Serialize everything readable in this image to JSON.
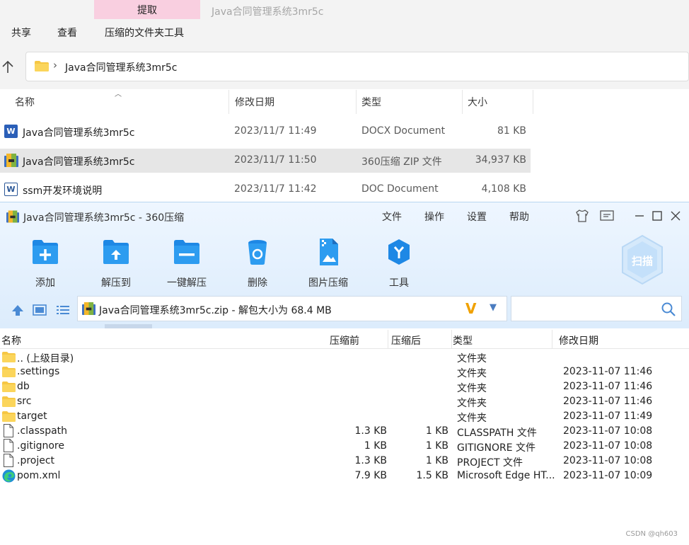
{
  "explorer": {
    "extract_tab": "提取",
    "window_title": "Java合同管理系统3mr5c",
    "menu": [
      "共享",
      "查看",
      "压缩的文件夹工具"
    ],
    "address": "Java合同管理系统3mr5c",
    "columns": [
      "名称",
      "修改日期",
      "类型",
      "大小"
    ],
    "files": [
      {
        "name": "Java合同管理系统3mr5c",
        "date": "2023/11/7 11:49",
        "type": "DOCX Document",
        "size": "81 KB",
        "icon": "word-docx-icon"
      },
      {
        "name": "Java合同管理系统3mr5c",
        "date": "2023/11/7 11:50",
        "type": "360压缩 ZIP 文件",
        "size": "34,937 KB",
        "icon": "zip-archive-icon"
      },
      {
        "name": "ssm开发环境说明",
        "date": "2023/11/7 11:42",
        "type": "DOC Document",
        "size": "4,108 KB",
        "icon": "word-doc-icon"
      }
    ]
  },
  "zip": {
    "title": "Java合同管理系统3mr5c - 360压缩",
    "menu": [
      "文件",
      "操作",
      "设置",
      "帮助"
    ],
    "tools": [
      "添加",
      "解压到",
      "一键解压",
      "删除",
      "图片压缩",
      "工具"
    ],
    "scan_label": "扫描",
    "path": "Java合同管理系统3mr5c.zip - 解包大小为 68.4 MB",
    "path_badge": "V",
    "columns": [
      "名称",
      "压缩前",
      "压缩后",
      "类型",
      "修改日期"
    ],
    "rows": [
      {
        "name": ".. (上级目录)",
        "before": "",
        "after": "",
        "type": "文件夹",
        "date": "",
        "icon": "folder-icon"
      },
      {
        "name": ".settings",
        "before": "",
        "after": "",
        "type": "文件夹",
        "date": "2023-11-07 11:46",
        "icon": "folder-icon"
      },
      {
        "name": "db",
        "before": "",
        "after": "",
        "type": "文件夹",
        "date": "2023-11-07 11:46",
        "icon": "folder-icon"
      },
      {
        "name": "src",
        "before": "",
        "after": "",
        "type": "文件夹",
        "date": "2023-11-07 11:46",
        "icon": "folder-icon"
      },
      {
        "name": "target",
        "before": "",
        "after": "",
        "type": "文件夹",
        "date": "2023-11-07 11:49",
        "icon": "folder-icon"
      },
      {
        "name": ".classpath",
        "before": "1.3 KB",
        "after": "1 KB",
        "type": "CLASSPATH 文件",
        "date": "2023-11-07 10:08",
        "icon": "file-icon"
      },
      {
        "name": ".gitignore",
        "before": "1 KB",
        "after": "1 KB",
        "type": "GITIGNORE 文件",
        "date": "2023-11-07 10:08",
        "icon": "file-icon"
      },
      {
        "name": ".project",
        "before": "1.3 KB",
        "after": "1 KB",
        "type": "PROJECT 文件",
        "date": "2023-11-07 10:08",
        "icon": "file-icon"
      },
      {
        "name": "pom.xml",
        "before": "7.9 KB",
        "after": "1.5 KB",
        "type": "Microsoft Edge HT...",
        "date": "2023-11-07 10:09",
        "icon": "edge-icon"
      }
    ]
  },
  "watermark": "CSDN @qh603",
  "colors": {
    "folder": "#f6c744",
    "accent_blue": "#1e88e5",
    "selected_row": "#e6e6e6",
    "extract_tab": "#f9cfe0"
  }
}
